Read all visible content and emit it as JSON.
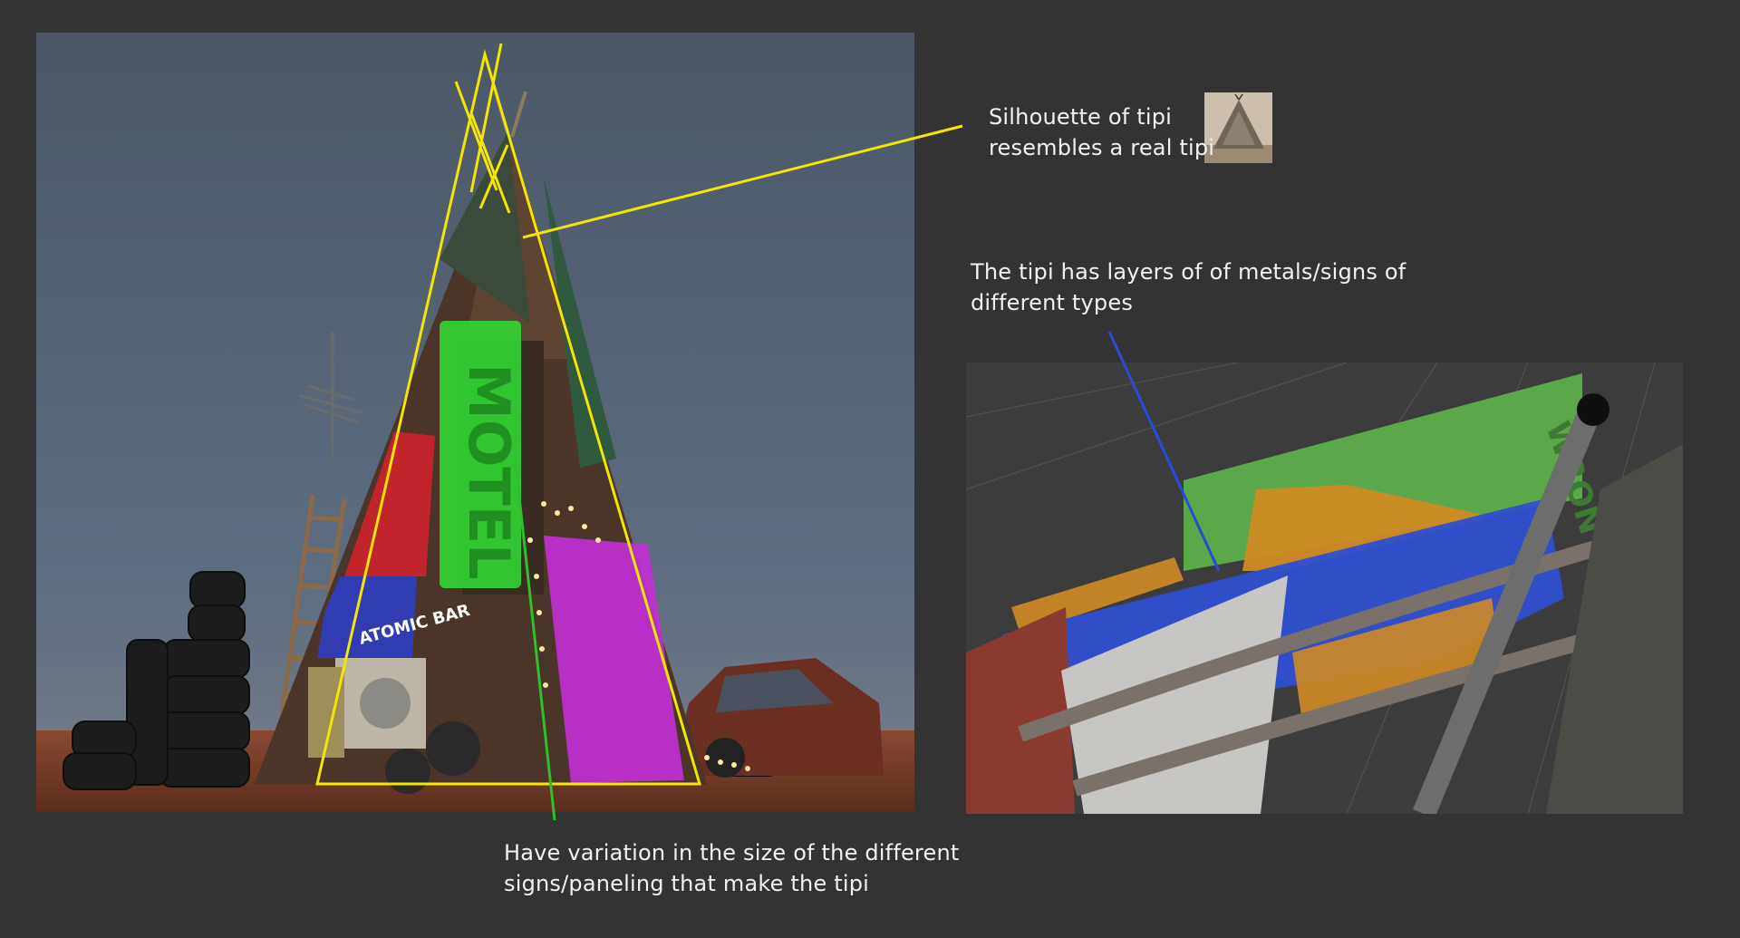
{
  "annotations": {
    "silhouette": {
      "line1": "Silhouette of tipi",
      "line2": "resembles a real tipi"
    },
    "layers": {
      "line1": "The tipi has layers of of metals/signs of",
      "line2": "different types"
    },
    "variation": {
      "line1": "Have variation in the size of the different",
      "line2": "signs/paneling that make the tipi"
    }
  },
  "signs": {
    "motel": "MOTEL",
    "atomic_bar": "ATOMIC BAR",
    "wrong_way": "WRON"
  },
  "colors": {
    "background": "#333333",
    "silhouette_outline": "#f5e600",
    "leader_blue": "#2a4bd8",
    "leader_green": "#2fbf2f",
    "highlight_green": "#33d633",
    "highlight_magenta": "#c42fd6",
    "highlight_red": "#d6212b",
    "highlight_blue": "#2b3fd6",
    "highlight_orange": "#d68a1e",
    "highlight_white": "#cfcfcf"
  }
}
